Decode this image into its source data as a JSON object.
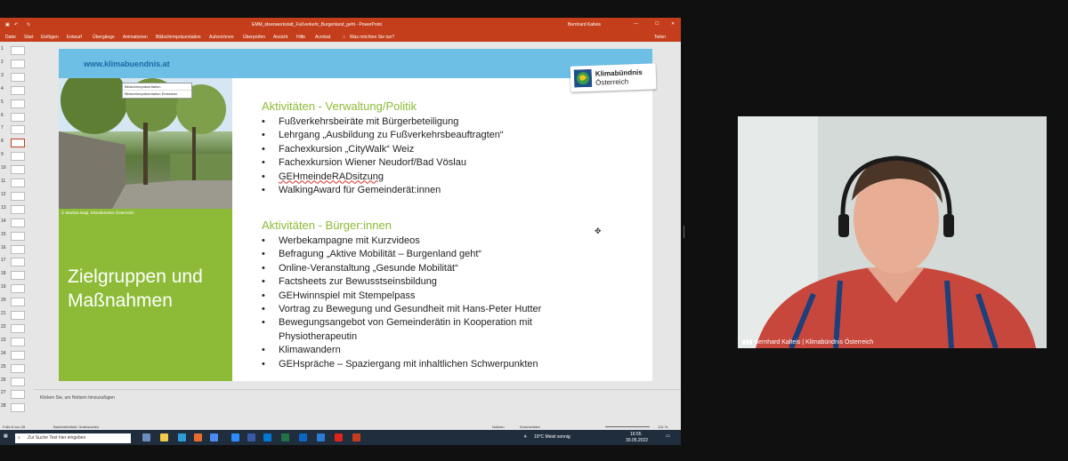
{
  "window": {
    "title": "EMM_ideenwerkstatt_Fußverkehr_Burgenland_geht  -  PowerPoint",
    "user": "Bernhard Kalteis"
  },
  "ribbon": {
    "tabs": [
      "Datei",
      "Start",
      "Einfügen",
      "Entwurf",
      "Übergänge",
      "Animationen",
      "Bildschirmpräsentation",
      "Aufzeichnen",
      "Überprüfen",
      "Ansicht",
      "Hilfe",
      "Acrobat"
    ],
    "tell_me": "Was möchten Sie tun?",
    "share": "Teilen"
  },
  "thumbnails": [
    "1",
    "2",
    "3",
    "4",
    "5",
    "6",
    "7",
    "8",
    "9",
    "10",
    "11",
    "12",
    "13",
    "14",
    "15",
    "16",
    "17",
    "18",
    "19",
    "20",
    "21",
    "22",
    "23",
    "24",
    "25",
    "26",
    "27",
    "28"
  ],
  "popup": {
    "line1": "Bildschirmpräsentation",
    "line2": "Bildschirmpräsentation Entsetzen"
  },
  "slide": {
    "url": "www.klimabuendnis.at",
    "credit": "© Martina Nagl, Klimabündnis Österreich",
    "title": "Zielgruppen und Maßnahmen",
    "logo_line1": "Klimabündnis",
    "logo_line2": "Österreich",
    "section1": {
      "heading": "Aktivitäten - Verwaltung/Politik",
      "items": [
        "Fußverkehrsbeiräte mit Bürgerbeteiligung",
        "Lehrgang „Ausbildung zu Fußverkehrsbeauftragten“",
        "Fachexkursion „CityWalk“ Weiz",
        "Fachexkursion Wiener Neudorf/Bad Vöslau",
        "GEHmeindeRADsitzung",
        "WalkingAward für Gemeinderät:innen"
      ]
    },
    "section2": {
      "heading": "Aktivitäten - Bürger:innen",
      "items": [
        "Werbekampagne mit Kurzvideos",
        "Befragung „Aktive Mobilität – Burgenland geht“",
        "Online-Veranstaltung „Gesunde Mobilität“",
        "Factsheets zur Bewusstseinsbildung",
        "GEHwinnspiel mit Stempelpass",
        "Vortrag zu Bewegung und Gesundheit mit Hans-Peter Hutter",
        "Bewegungsangebot von Gemeinderätin in Kooperation mit Physiotherapeutin",
        "Klimawandern",
        "GEHspräche – Spaziergang mit inhaltlichen Schwerpunkten"
      ]
    }
  },
  "notes": {
    "placeholder": "Klicken Sie, um Notizen hinzuzufügen"
  },
  "status": {
    "slide": "Folie 8 von 28",
    "accessibility": "Barrierefreiheit: Untersuchen",
    "notes": "Notizen",
    "comments": "Kommentare",
    "zoom": "131 %"
  },
  "taskbar": {
    "search_placeholder": "Zur Suche Text hier eingeben",
    "weather": "19°C  Meist sonnig",
    "time": "16:55",
    "date": "30.05.2022"
  },
  "webcam": {
    "name": "Bernhard Kalteis | Klimabündnis Österreich"
  },
  "colors": {
    "ppt_red": "#c43e1c",
    "slide_green": "#8dbb37",
    "slide_blue": "#6ebfe6"
  }
}
